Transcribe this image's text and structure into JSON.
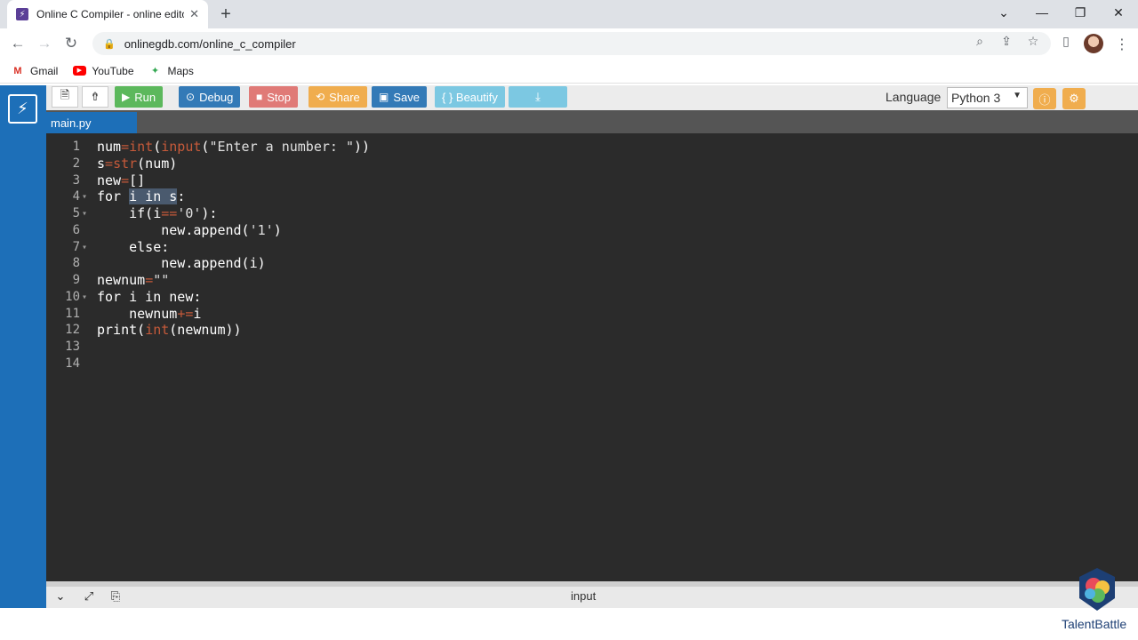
{
  "browser": {
    "tab_title": "Online C Compiler - online editor",
    "url": "onlinegdb.com/online_c_compiler",
    "bookmarks": [
      {
        "label": "Gmail",
        "icon": "gmail-icon",
        "color": "#d93025"
      },
      {
        "label": "YouTube",
        "icon": "youtube-icon",
        "color": "#ff0000"
      },
      {
        "label": "Maps",
        "icon": "maps-icon",
        "color": "#34a853"
      }
    ]
  },
  "toolbar": {
    "run": "Run",
    "debug": "Debug",
    "stop": "Stop",
    "share": "Share",
    "save": "Save",
    "beautify": "{ } Beautify",
    "language_label": "Language",
    "language_value": "Python 3",
    "colors": {
      "run": "#5cb85c",
      "debug": "#337ab7",
      "stop": "#d9534f",
      "share": "#f0ad4e",
      "save": "#337ab7",
      "beautify": "#5bc0de",
      "download": "#5bc0de"
    }
  },
  "file_tab": "main.py",
  "code_lines": [
    {
      "n": "1",
      "text": "num=int(input(\"Enter a number: \"))"
    },
    {
      "n": "2",
      "text": "s=str(num)"
    },
    {
      "n": "3",
      "text": "new=[]"
    },
    {
      "n": "4",
      "text": "for i in s:"
    },
    {
      "n": "5",
      "text": "    if(i=='0'):"
    },
    {
      "n": "6",
      "text": "        new.append('1')"
    },
    {
      "n": "7",
      "text": "    else:"
    },
    {
      "n": "8",
      "text": "        new.append(i)"
    },
    {
      "n": "9",
      "text": "newnum=\"\""
    },
    {
      "n": "10",
      "text": "for i in new:"
    },
    {
      "n": "11",
      "text": "    newnum+=i"
    },
    {
      "n": "12",
      "text": "print(int(newnum))"
    },
    {
      "n": "13",
      "text": ""
    },
    {
      "n": "14",
      "text": ""
    }
  ],
  "bottom_panel": {
    "title": "input"
  },
  "watermark": "TalentBattle"
}
